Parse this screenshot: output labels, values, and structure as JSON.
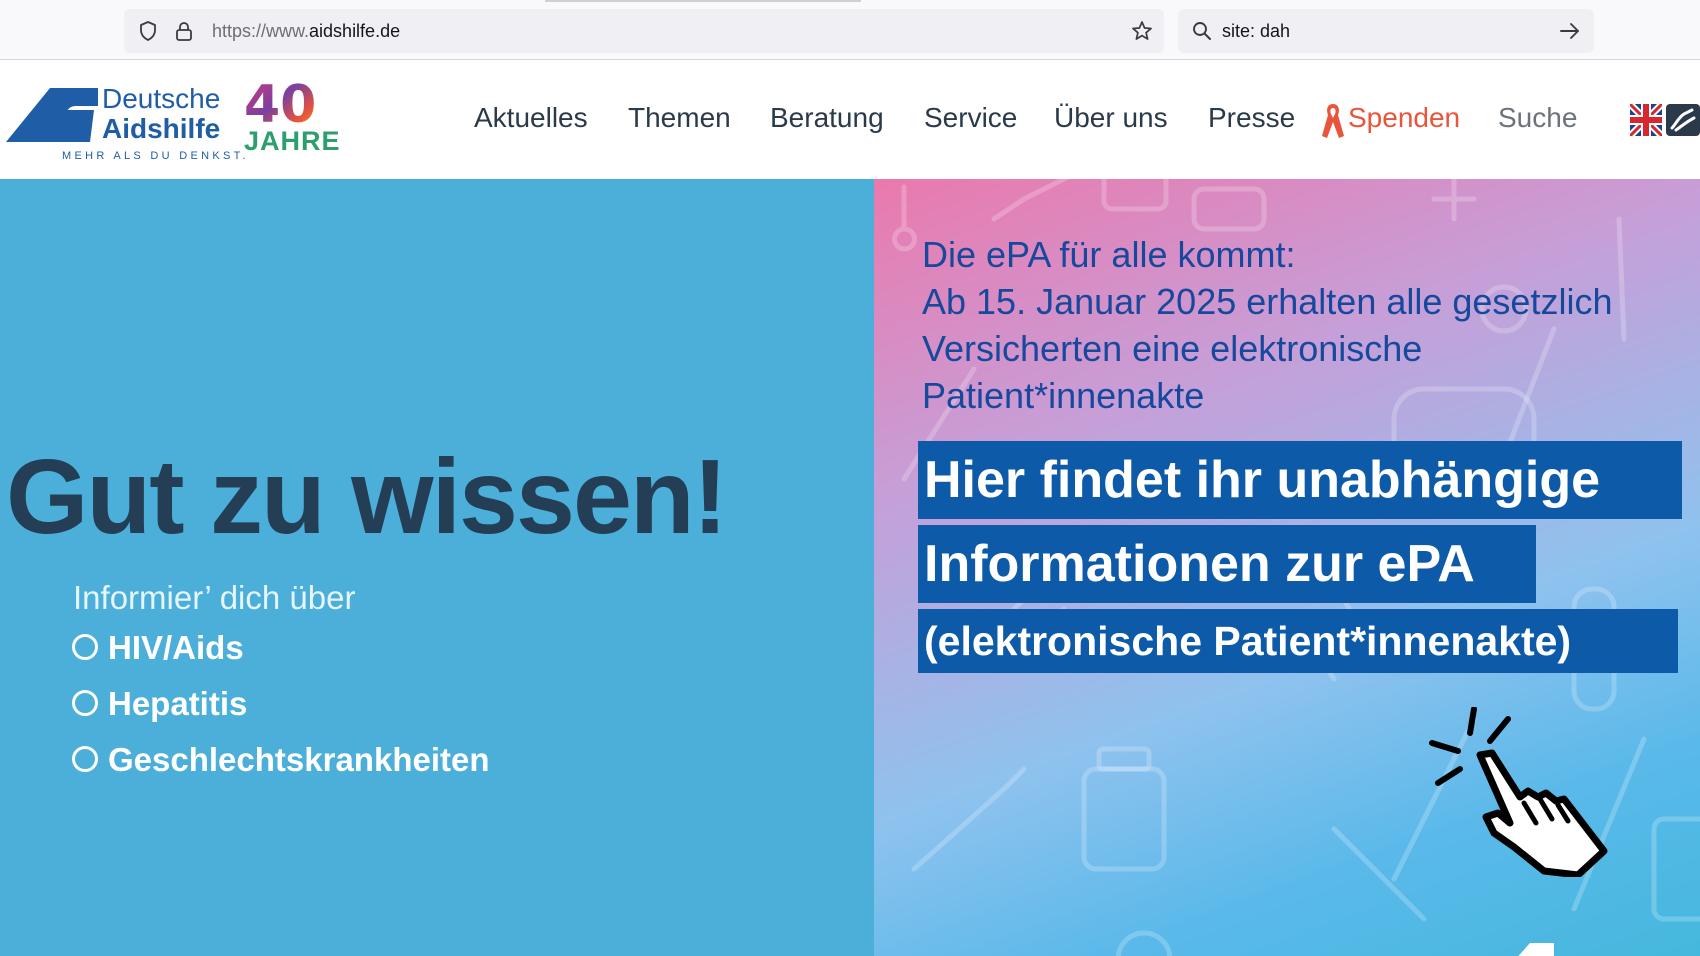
{
  "browser": {
    "url_prefix": "https://www.",
    "url_domain": "aidshilfe.de",
    "search_query": "site: dah",
    "icons": [
      "shield-icon",
      "lock-icon",
      "star-icon",
      "search-icon",
      "arrow-right-icon"
    ]
  },
  "header": {
    "logo": {
      "line1": "Deutsche",
      "line2": "Aidshilfe",
      "tagline": "MEHR ALS DU DENKST.",
      "anniversary_number": "40",
      "anniversary_word": "JAHRE"
    },
    "nav": [
      {
        "label": "Aktuelles"
      },
      {
        "label": "Themen"
      },
      {
        "label": "Beratung"
      },
      {
        "label": "Service"
      },
      {
        "label": "Über uns"
      },
      {
        "label": "Presse"
      },
      {
        "label": "Spenden"
      },
      {
        "label": "Suche"
      }
    ],
    "icons": [
      "red-ribbon-icon",
      "uk-flag-icon",
      "sign-language-icon"
    ]
  },
  "hero": {
    "title": "Gut zu wissen!",
    "intro": "Informier’ dich über",
    "topics": [
      "HIV/Aids",
      "Hepatitis",
      "Geschlechtskrankheiten"
    ]
  },
  "banner": {
    "intro_lines": [
      "Die ePA für alle kommt:",
      "Ab 15. Januar 2025 erhalten alle gesetzlich",
      "Versicherten eine elektronische",
      "Patient*innenakte"
    ],
    "cta_lines": [
      "Hier findet ihr unabhängige",
      "Informationen zur ePA",
      "(elektronische Patient*innenakte)"
    ],
    "icon": "click-hand-icon"
  },
  "colors": {
    "hero_left_bg": "#4bafda",
    "hero_title": "#243e55",
    "cta_bg": "#0d5aa8",
    "brand_blue": "#1f5da6",
    "donate": "#e8553a"
  }
}
